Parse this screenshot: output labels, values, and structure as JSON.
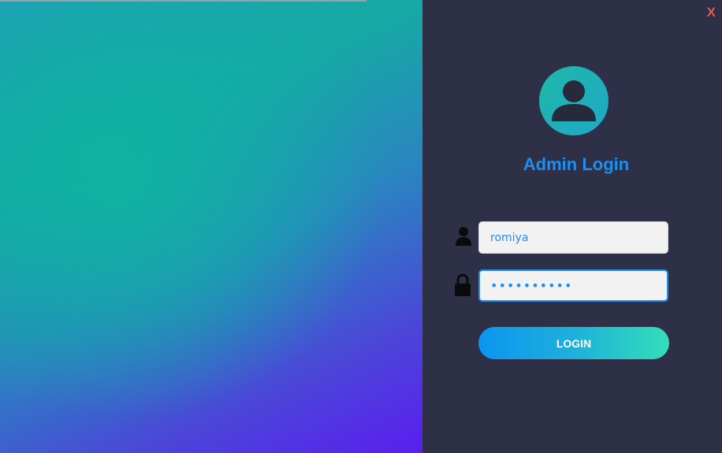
{
  "window": {
    "close_label": "X"
  },
  "login": {
    "title": "Admin Login",
    "username_value": "romiya",
    "password_value": "••••••••••",
    "button_label": "LOGIN"
  },
  "colors": {
    "accent": "#1e8ef0",
    "panel": "#2e3047",
    "close": "#e05a4e"
  },
  "icons": {
    "avatar": "user-avatar-icon",
    "username": "user-icon",
    "password": "lock-icon"
  }
}
